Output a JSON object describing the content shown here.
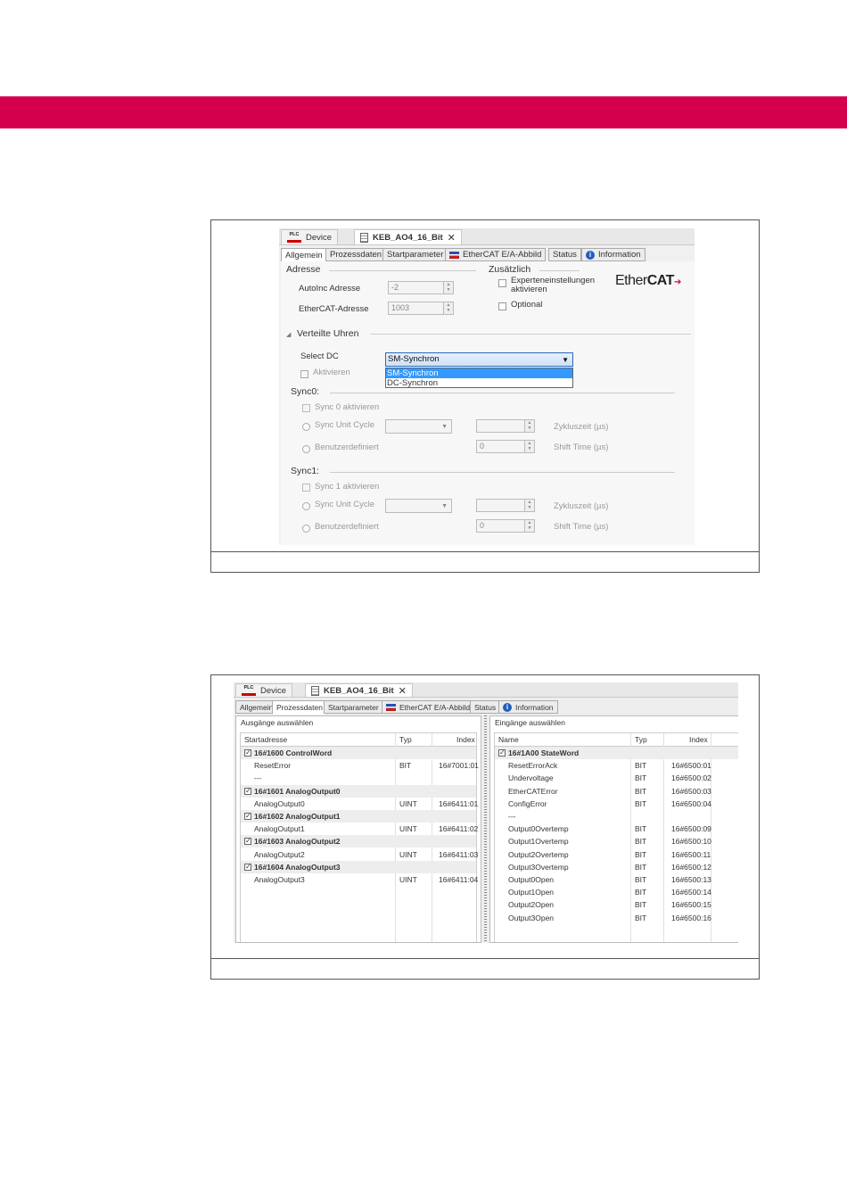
{
  "colors": {
    "banner": "#d4004c",
    "selection": "#3399ff"
  },
  "fig1": {
    "doc_tabs": {
      "device": "Device",
      "module": "KEB_AO4_16_Bit",
      "plc_label": "PLC"
    },
    "sub_tabs": [
      "Allgemein",
      "Prozessdaten",
      "Startparameter",
      "EtherCAT E/A-Abbild",
      "Status",
      "Information"
    ],
    "adresse": {
      "heading": "Adresse",
      "autoinc_label": "AutoInc Adresse",
      "autoinc_value": "-2",
      "ecat_label": "EtherCAT-Adresse",
      "ecat_value": "1003"
    },
    "zusaetzlich": {
      "heading": "Zusätzlich",
      "experten_line1": "Experteneinstellungen",
      "experten_line2": "aktivieren",
      "optional": "Optional"
    },
    "logo": {
      "part1": "Ether",
      "part2": "CAT"
    },
    "verteilte_uhren": {
      "heading": "Verteilte Uhren",
      "select_dc_label": "Select DC",
      "select_dc_value": "SM-Synchron",
      "options": [
        "SM-Synchron",
        "DC-Synchron"
      ],
      "aktivieren": "Aktivieren"
    },
    "sync0": {
      "heading": "Sync0:",
      "aktivieren": "Sync 0 aktivieren",
      "unit_cycle": "Sync Unit Cycle",
      "benutzer": "Benutzerdefiniert",
      "zyklus": "Zykluszeit (µs)",
      "shift": "Shift Time (µs)",
      "shift_value": "0"
    },
    "sync1": {
      "heading": "Sync1:",
      "aktivieren": "Sync 1 aktivieren",
      "unit_cycle": "Sync Unit Cycle",
      "benutzer": "Benutzerdefiniert",
      "zyklus": "Zykluszeit (µs)",
      "shift": "Shift Time (µs)",
      "shift_value": "0"
    }
  },
  "fig2": {
    "doc_tabs": {
      "device": "Device",
      "module": "KEB_AO4_16_Bit",
      "plc_label": "PLC"
    },
    "sub_tabs": [
      "Allgemein",
      "Prozessdaten",
      "Startparameter",
      "EtherCAT E/A-Abbild",
      "Status",
      "Information"
    ],
    "outputs": {
      "title": "Ausgänge auswählen",
      "columns": [
        "Startadresse",
        "Typ",
        "Index"
      ],
      "rows": [
        {
          "name": "16#1600 ControlWord",
          "typ": "",
          "index": "",
          "group": true,
          "checked": true
        },
        {
          "name": "ResetError",
          "typ": "BIT",
          "index": "16#7001:01",
          "group": false
        },
        {
          "name": "---",
          "typ": "",
          "index": "",
          "group": false
        },
        {
          "name": "16#1601 AnalogOutput0",
          "typ": "",
          "index": "",
          "group": true,
          "checked": true
        },
        {
          "name": "AnalogOutput0",
          "typ": "UINT",
          "index": "16#6411:01",
          "group": false
        },
        {
          "name": "16#1602 AnalogOutput1",
          "typ": "",
          "index": "",
          "group": true,
          "checked": true
        },
        {
          "name": "AnalogOutput1",
          "typ": "UINT",
          "index": "16#6411:02",
          "group": false
        },
        {
          "name": "16#1603 AnalogOutput2",
          "typ": "",
          "index": "",
          "group": true,
          "checked": true
        },
        {
          "name": "AnalogOutput2",
          "typ": "UINT",
          "index": "16#6411:03",
          "group": false
        },
        {
          "name": "16#1604 AnalogOutput3",
          "typ": "",
          "index": "",
          "group": true,
          "checked": true
        },
        {
          "name": "AnalogOutput3",
          "typ": "UINT",
          "index": "16#6411:04",
          "group": false
        }
      ]
    },
    "inputs": {
      "title": "Eingänge auswählen",
      "columns": [
        "Name",
        "Typ",
        "Index"
      ],
      "rows": [
        {
          "name": "16#1A00 StateWord",
          "typ": "",
          "index": "",
          "group": true,
          "checked": true
        },
        {
          "name": "ResetErrorAck",
          "typ": "BIT",
          "index": "16#6500:01",
          "group": false
        },
        {
          "name": "Undervoltage",
          "typ": "BIT",
          "index": "16#6500:02",
          "group": false
        },
        {
          "name": "EtherCATError",
          "typ": "BIT",
          "index": "16#6500:03",
          "group": false
        },
        {
          "name": "ConfigError",
          "typ": "BIT",
          "index": "16#6500:04",
          "group": false
        },
        {
          "name": "---",
          "typ": "",
          "index": "",
          "group": false
        },
        {
          "name": "Output0Overtemp",
          "typ": "BIT",
          "index": "16#6500:09",
          "group": false
        },
        {
          "name": "Output1Overtemp",
          "typ": "BIT",
          "index": "16#6500:10",
          "group": false
        },
        {
          "name": "Output2Overtemp",
          "typ": "BIT",
          "index": "16#6500:11",
          "group": false
        },
        {
          "name": "Output3Overtemp",
          "typ": "BIT",
          "index": "16#6500:12",
          "group": false
        },
        {
          "name": "Output0Open",
          "typ": "BIT",
          "index": "16#6500:13",
          "group": false
        },
        {
          "name": "Output1Open",
          "typ": "BIT",
          "index": "16#6500:14",
          "group": false
        },
        {
          "name": "Output2Open",
          "typ": "BIT",
          "index": "16#6500:15",
          "group": false
        },
        {
          "name": "Output3Open",
          "typ": "BIT",
          "index": "16#6500:16",
          "group": false
        }
      ]
    }
  }
}
